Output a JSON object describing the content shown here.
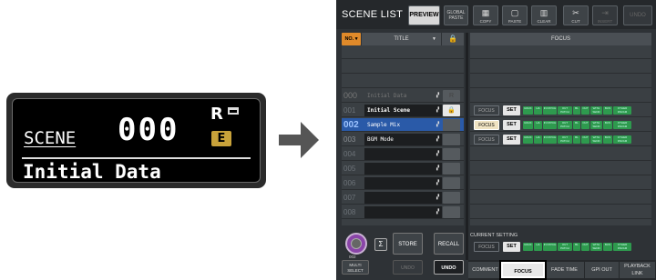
{
  "scene_display": {
    "label": "SCENE",
    "number": "000",
    "r_mark": "R",
    "e_mark": "E",
    "title": "Initial Data"
  },
  "screen": {
    "title": "SCENE LIST",
    "toolbar": {
      "preview": "PREVIEW",
      "global_paste": "GLOBAL PASTE",
      "copy": "COPY",
      "paste": "PASTE",
      "clear": "CLEAR",
      "cut": "CUT",
      "insert": "INSERT",
      "undo": "UNDO"
    },
    "headers": {
      "no": "NO.",
      "title": "TITLE",
      "focus": "FOCUS"
    },
    "scenes": [
      {
        "num": "000",
        "title": "Initial Data",
        "locked": false
      },
      {
        "num": "001",
        "title": "Initial Scene",
        "locked": true
      },
      {
        "num": "002",
        "title": "Sample Mix",
        "locked": false
      },
      {
        "num": "003",
        "title": "BGM Mode",
        "locked": false
      },
      {
        "num": "004",
        "title": "",
        "locked": false
      },
      {
        "num": "005",
        "title": "",
        "locked": false
      },
      {
        "num": "006",
        "title": "",
        "locked": false
      },
      {
        "num": "007",
        "title": "",
        "locked": false
      },
      {
        "num": "008",
        "title": "",
        "locked": false
      }
    ],
    "focus_label": "FOCUS",
    "set_label": "SET",
    "chips": [
      "RACK",
      "HA",
      "IN PATCH",
      "OUT PATCH",
      "BL",
      "OUT",
      "WITH SEND",
      "BUS",
      "OTHER PARAM"
    ],
    "current_setting": "CURRENT SETTING",
    "bottom": {
      "knob_value": "002",
      "store": "STORE",
      "recall": "RECALL",
      "multi_select": "MULTI SELECT",
      "undo": "UNDO"
    },
    "tabs": [
      "COMMENT",
      "FOCUS",
      "FADE TIME",
      "GPI OUT",
      "PLAYBACK LINK"
    ],
    "active_tab": "FOCUS"
  },
  "colors": {
    "accent_blue": "#2a5aa8",
    "orange": "#e08a2a",
    "green_chip": "#2e9a4e",
    "e_badge": "#c8a23a",
    "knob": "#8a45a8"
  }
}
